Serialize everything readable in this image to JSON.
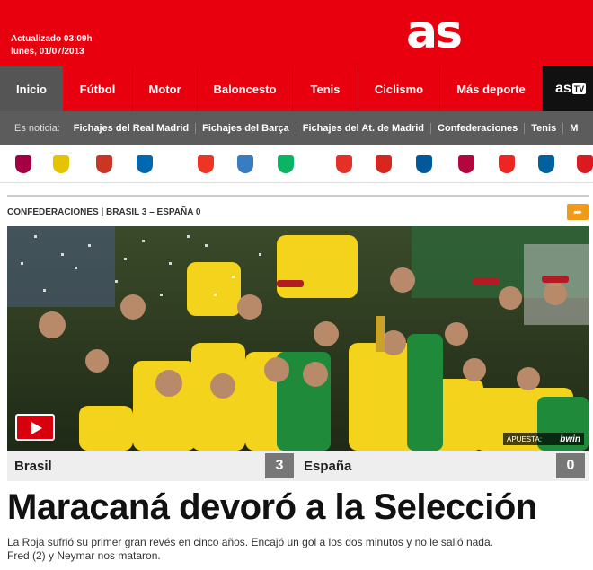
{
  "header": {
    "updated_line1": "Actualizado 03:09h",
    "updated_line2": "lunes, 01/07/2013",
    "logo": "as",
    "brand_color": "#e8000f"
  },
  "nav": {
    "items": [
      {
        "label": "Inicio",
        "active": true
      },
      {
        "label": "Fútbol"
      },
      {
        "label": "Motor"
      },
      {
        "label": "Baloncesto"
      },
      {
        "label": "Tenis"
      },
      {
        "label": "Ciclismo"
      },
      {
        "label": "Más deporte"
      }
    ],
    "astv_label": "as",
    "astv_badge": "TV"
  },
  "subnav": {
    "label": "Es noticia:",
    "links": [
      "Fichajes del Real Madrid",
      "Fichajes del Barça",
      "Fichajes del At. de Madrid",
      "Confederaciones",
      "Tenis",
      "M"
    ]
  },
  "crests": [
    {
      "name": "barcelona-crest-icon",
      "color": "#a50044"
    },
    {
      "name": "real-madrid-crest-icon",
      "color": "#e6c200"
    },
    {
      "name": "atletico-crest-icon",
      "color": "#cb3524"
    },
    {
      "name": "real-sociedad-crest-icon",
      "color": "#0067b1"
    },
    {
      "name": "valencia-crest-icon",
      "color": "#ee3524"
    },
    {
      "name": "malaga-crest-icon",
      "color": "#3a7cc1"
    },
    {
      "name": "betis-crest-icon",
      "color": "#0bb363"
    },
    {
      "name": "rayo-crest-icon",
      "color": "#e53027"
    },
    {
      "name": "sevilla-crest-icon",
      "color": "#d7261e"
    },
    {
      "name": "getafe-crest-icon",
      "color": "#005999"
    },
    {
      "name": "levante-crest-icon",
      "color": "#b4053f"
    },
    {
      "name": "athletic-crest-icon",
      "color": "#ee2523"
    },
    {
      "name": "espanyol-crest-icon",
      "color": "#0061a0"
    },
    {
      "name": "osasuna-crest-icon",
      "color": "#d91a21"
    }
  ],
  "section": {
    "label": "CONFEDERACIONES | BRASIL 3 – ESPAÑA 0",
    "share_icon": "share-arrow-icon"
  },
  "photo": {
    "sponsor_text": "APUESTA:",
    "sponsor_brand": "bwin"
  },
  "score": {
    "team1": "Brasil",
    "score1": "3",
    "team2": "España",
    "score2": "0"
  },
  "article": {
    "headline": "Maracaná devoró a la Selección",
    "summary_line1": "La Roja sufrió su primer gran revés en cinco años. Encajó un gol a los dos minutos y no le salió nada.",
    "summary_line2": "Fred (2) y Neymar nos mataron."
  }
}
